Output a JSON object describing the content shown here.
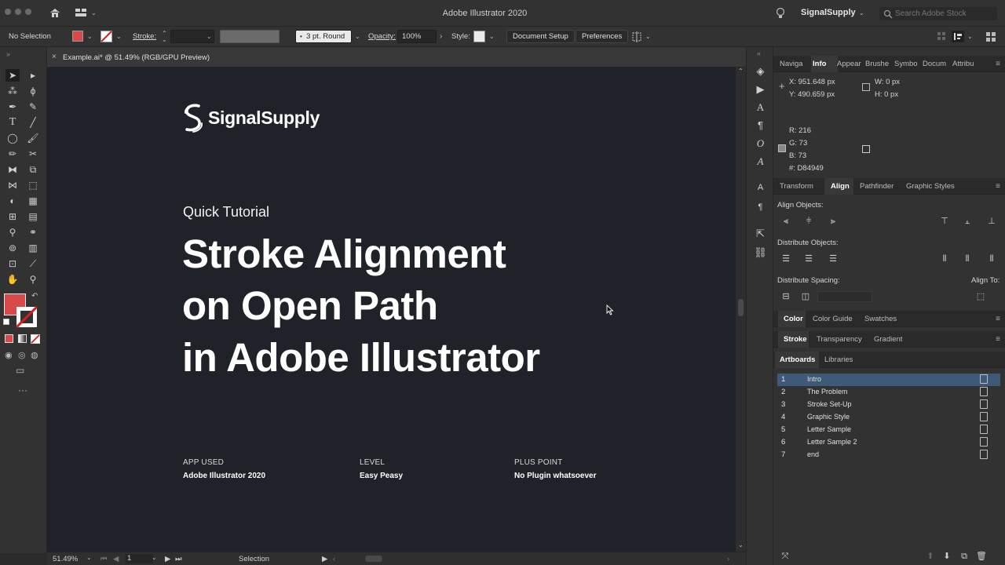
{
  "window": {
    "app_title": "Adobe Illustrator 2020",
    "user": "SignalSupply",
    "stock_search_placeholder": "Search Adobe Stock"
  },
  "control_bar": {
    "selection_status": "No Selection",
    "stroke_label": "Stroke:",
    "brush_value": "3 pt. Round",
    "opacity_label": "Opacity:",
    "opacity_value": "100%",
    "style_label": "Style:",
    "document_setup": "Document Setup",
    "preferences": "Preferences"
  },
  "colors": {
    "fill": "#D84949",
    "accent_selection": "#3E5A78",
    "canvas_bg": "#1F2228"
  },
  "document": {
    "tab_label": "Example.ai* @ 51.49% (RGB/GPU Preview)"
  },
  "artboard": {
    "brand_name": "SignalSupply",
    "subtitle": "Quick Tutorial",
    "headline": [
      "Stroke Alignment",
      "on Open Path",
      "in Adobe Illustrator"
    ],
    "meta": [
      {
        "label": "APP USED",
        "value": "Adobe Illustrator 2020"
      },
      {
        "label": "LEVEL",
        "value": "Easy Peasy"
      },
      {
        "label": "PLUS POINT",
        "value": "No Plugin whatsoever"
      }
    ]
  },
  "status_bar": {
    "zoom": "51.49%",
    "artboard_number": "1",
    "tool": "Selection"
  },
  "info_panel": {
    "tabs": [
      "Naviga",
      "Info",
      "Appear",
      "Brushe",
      "Symbo",
      "Docum",
      "Attribu"
    ],
    "active_tab": "Info",
    "x": "X: 951.648 px",
    "y": "Y: 490.659 px",
    "w": "W: 0 px",
    "h": "H: 0 px",
    "r": "R: 216",
    "g": "G: 73",
    "b": "B: 73",
    "hex": "#: D84949"
  },
  "align_panel": {
    "tabs": [
      "Transform",
      "Align",
      "Pathfinder",
      "Graphic Styles"
    ],
    "active_tab": "Align",
    "align_objects": "Align Objects:",
    "distribute_objects": "Distribute Objects:",
    "distribute_spacing": "Distribute Spacing:",
    "align_to": "Align To:"
  },
  "color_panel": {
    "tabs": [
      "Color",
      "Color Guide",
      "Swatches"
    ],
    "active_tab": "Color"
  },
  "stroke_panel": {
    "tabs": [
      "Stroke",
      "Transparency",
      "Gradient"
    ],
    "active_tab": "Stroke"
  },
  "artboards_panel": {
    "tabs": [
      "Artboards",
      "Libraries"
    ],
    "active_tab": "Artboards",
    "items": [
      {
        "num": "1",
        "name": "Intro",
        "selected": true
      },
      {
        "num": "2",
        "name": "The Problem",
        "selected": false
      },
      {
        "num": "3",
        "name": "Stroke Set-Up",
        "selected": false
      },
      {
        "num": "4",
        "name": "Graphic Style",
        "selected": false
      },
      {
        "num": "5",
        "name": "Letter Sample",
        "selected": false
      },
      {
        "num": "6",
        "name": "Letter Sample 2",
        "selected": false
      },
      {
        "num": "7",
        "name": "end",
        "selected": false
      }
    ]
  }
}
